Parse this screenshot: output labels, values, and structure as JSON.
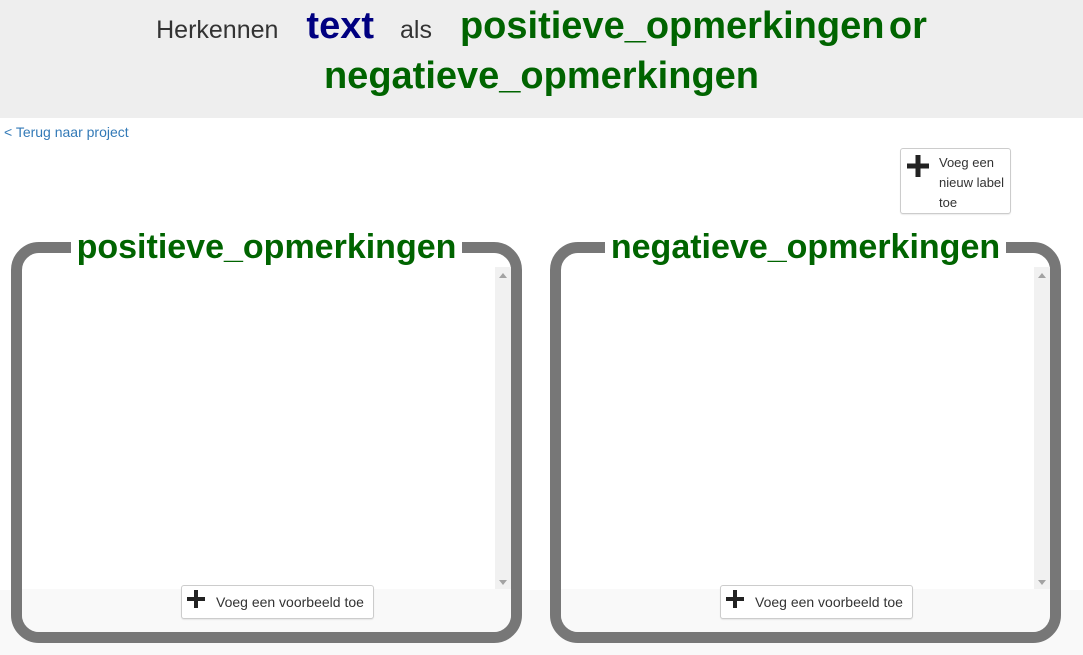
{
  "header": {
    "prefix": "Herkennen",
    "type": "text",
    "middle": "als",
    "label_one": "positieve_opmerkingen",
    "connector": "or",
    "label_two": "negatieve_opmerkingen"
  },
  "nav": {
    "back_link": "< Terug naar project"
  },
  "toolbar": {
    "new_label_button": "Voeg een nieuw label toe",
    "new_label_icon": "plus-icon"
  },
  "buckets": [
    {
      "label": "positieve_opmerkingen",
      "add_example_button": "Voeg een voorbeeld toe",
      "add_example_icon": "plus-icon"
    },
    {
      "label": "negatieve_opmerkingen",
      "add_example_button": "Voeg een voorbeeld toe",
      "add_example_icon": "plus-icon"
    }
  ],
  "colors": {
    "label_green": "#006400",
    "type_navy": "#000080",
    "link_blue": "#337ab7",
    "bucket_border": "#777777",
    "header_bg": "#eeeeee"
  }
}
